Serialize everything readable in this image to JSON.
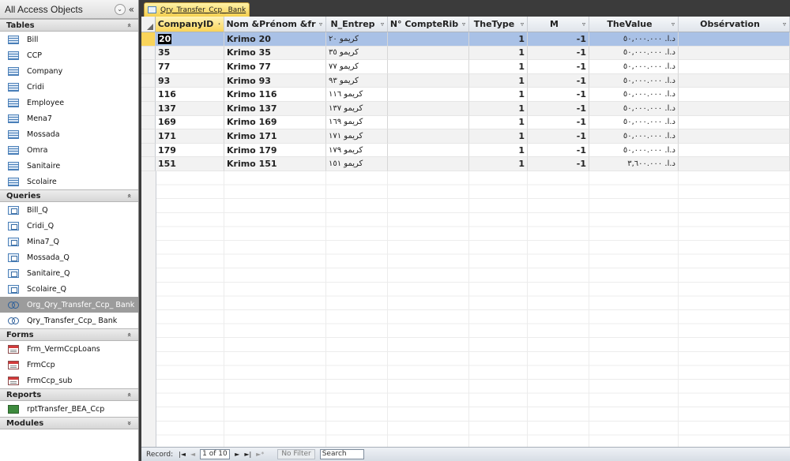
{
  "nav": {
    "title": "All Access Objects",
    "groups": {
      "tables": {
        "label": "Tables",
        "items": [
          "Bill",
          "CCP",
          "Company",
          "Cridi",
          "Employee",
          "Mena7",
          "Mossada",
          "Omra",
          "Sanitaire",
          "Scolaire"
        ]
      },
      "queries": {
        "label": "Queries",
        "items": [
          "Bill_Q",
          "Cridi_Q",
          "Mina7_Q",
          "Mossada_Q",
          "Sanitaire_Q",
          "Scolaire_Q",
          "Org_Qry_Transfer_Ccp_ Bank",
          "Qry_Transfer_Ccp_ Bank"
        ],
        "selected": "Org_Qry_Transfer_Ccp_ Bank"
      },
      "forms": {
        "label": "Forms",
        "items": [
          "Frm_VermCcpLoans",
          "FrmCcp",
          "FrmCcp_sub"
        ]
      },
      "reports": {
        "label": "Reports",
        "items": [
          "rptTransfer_BEA_Ccp"
        ]
      },
      "modules": {
        "label": "Modules"
      }
    }
  },
  "tab": {
    "label": "Qry_Transfer_Ccp_ Bank"
  },
  "grid": {
    "columns": [
      "CompanyID",
      "Nom &Prénom &fr",
      "N_Entrep",
      "N° CompteRib",
      "TheType",
      "M",
      "TheValue",
      "Obsérvation"
    ],
    "rows": [
      [
        "20",
        "Krimo 20",
        "كريمو ٢٠",
        "",
        "1",
        "-1",
        "د.ا. ٥٠,٠٠٠.٠٠٠",
        ""
      ],
      [
        "35",
        "Krimo 35",
        "كريمو ٣٥",
        "",
        "1",
        "-1",
        "د.ا. ٥٠,٠٠٠.٠٠٠",
        ""
      ],
      [
        "77",
        "Krimo 77",
        "كريمو ٧٧",
        "",
        "1",
        "-1",
        "د.ا. ٥٠,٠٠٠.٠٠٠",
        ""
      ],
      [
        "93",
        "Krimo 93",
        "كريمو ٩٣",
        "",
        "1",
        "-1",
        "د.ا. ٥٠,٠٠٠.٠٠٠",
        ""
      ],
      [
        "116",
        "Krimo 116",
        "كريمو ١١٦",
        "",
        "1",
        "-1",
        "د.ا. ٥٠,٠٠٠.٠٠٠",
        ""
      ],
      [
        "137",
        "Krimo 137",
        "كريمو ١٣٧",
        "",
        "1",
        "-1",
        "د.ا. ٥٠,٠٠٠.٠٠٠",
        ""
      ],
      [
        "169",
        "Krimo 169",
        "كريمو ١٦٩",
        "",
        "1",
        "-1",
        "د.ا. ٥٠,٠٠٠.٠٠٠",
        ""
      ],
      [
        "171",
        "Krimo 171",
        "كريمو ١٧١",
        "",
        "1",
        "-1",
        "د.ا. ٥٠,٠٠٠.٠٠٠",
        ""
      ],
      [
        "179",
        "Krimo 179",
        "كريمو ١٧٩",
        "",
        "1",
        "-1",
        "د.ا. ٥٠,٠٠٠.٠٠٠",
        ""
      ],
      [
        "151",
        "Krimo 151",
        "كريمو ١٥١",
        "",
        "1",
        "-1",
        "د.ا. ٣,٦٠٠.٠٠٠",
        ""
      ]
    ]
  },
  "status": {
    "record_label": "Record:",
    "record_value": "1 of 10",
    "filter_label": "No Filter",
    "search_placeholder": "Search"
  }
}
